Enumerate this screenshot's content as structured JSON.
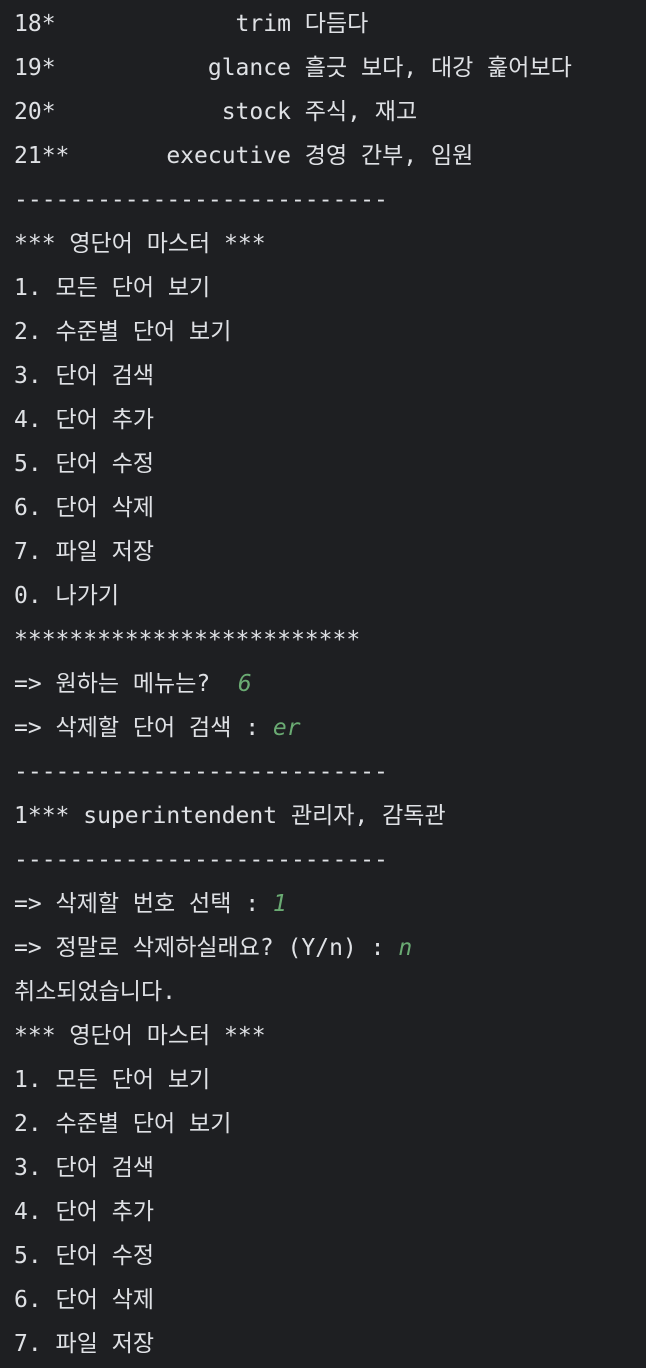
{
  "console": {
    "lines": [
      {
        "text": "18*             trim 다듬다"
      },
      {
        "text": "19*           glance 흘긋 보다, 대강 훑어보다"
      },
      {
        "text": "20*            stock 주식, 재고"
      },
      {
        "text": "21**       executive 경영 간부, 임원"
      },
      {
        "text": "---------------------------"
      },
      {
        "text": "*** 영단어 마스터 ***"
      },
      {
        "text": "1. 모든 단어 보기"
      },
      {
        "text": "2. 수준별 단어 보기"
      },
      {
        "text": "3. 단어 검색"
      },
      {
        "text": "4. 단어 추가"
      },
      {
        "text": "5. 단어 수정"
      },
      {
        "text": "6. 단어 삭제"
      },
      {
        "text": "7. 파일 저장"
      },
      {
        "text": "0. 나가기"
      },
      {
        "text": "*************************"
      },
      {
        "text": "=> 원하는 메뉴는?  ",
        "input": "6"
      },
      {
        "text": "=> 삭제할 단어 검색 : ",
        "input": "er"
      },
      {
        "text": "---------------------------"
      },
      {
        "text": "1*** superintendent 관리자, 감독관"
      },
      {
        "text": "---------------------------"
      },
      {
        "text": "=> 삭제할 번호 선택 : ",
        "input": "1"
      },
      {
        "text": "=> 정말로 삭제하실래요? (Y/n) : ",
        "input": "n"
      },
      {
        "text": "취소되었습니다."
      },
      {
        "text": "*** 영단어 마스터 ***"
      },
      {
        "text": "1. 모든 단어 보기"
      },
      {
        "text": "2. 수준별 단어 보기"
      },
      {
        "text": "3. 단어 검색"
      },
      {
        "text": "4. 단어 추가"
      },
      {
        "text": "5. 단어 수정"
      },
      {
        "text": "6. 단어 삭제"
      },
      {
        "text": "7. 파일 저장"
      }
    ]
  }
}
